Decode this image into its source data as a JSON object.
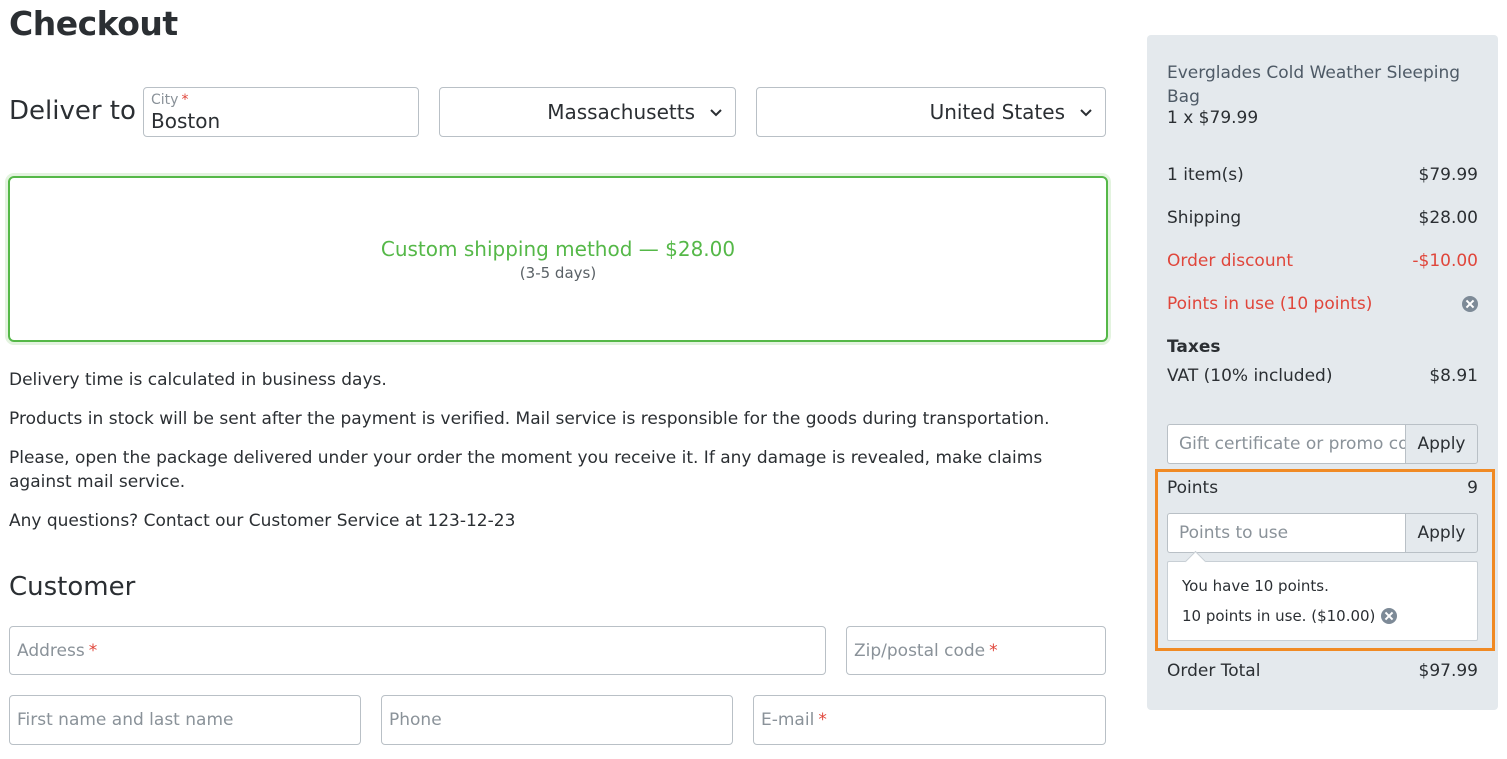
{
  "page": {
    "title": "Checkout"
  },
  "delivery": {
    "label": "Deliver to",
    "city_label": "City",
    "required_mark": "*",
    "city_value": "Boston",
    "state_value": "Massachusetts",
    "country_value": "United States"
  },
  "shipping": {
    "method": "Custom shipping method — $28.00",
    "days": "(3-5 days)"
  },
  "info": [
    "Delivery time is calculated in business days.",
    "Products in stock will be sent after the payment is verified. Mail service is responsible for the goods during transportation.",
    "Please, open the package delivered under your order the moment you receive it. If any damage is revealed, make claims against mail service.",
    "Any questions? Contact our Customer Service at 123-12-23"
  ],
  "customer": {
    "heading": "Customer",
    "address_placeholder": "Address",
    "zip_placeholder": "Zip/postal code",
    "name_placeholder": "First name and last name",
    "phone_placeholder": "Phone",
    "email_placeholder": "E-mail",
    "required_mark": "*"
  },
  "summary": {
    "product_name": "Everglades Cold Weather Sleeping Bag",
    "product_qty": "1 x $79.99",
    "items_label": "1 item(s)",
    "items_value": "$79.99",
    "shipping_label": "Shipping",
    "shipping_value": "$28.00",
    "discount_label": "Order discount",
    "discount_value": "-$10.00",
    "points_in_use_label": "Points in use (10 points)",
    "taxes_heading": "Taxes",
    "vat_label": "VAT (10% included)",
    "vat_value": "$8.91",
    "promo_placeholder": "Gift certificate or promo code",
    "promo_apply": "Apply",
    "points_label": "Points",
    "points_value": "9",
    "points_placeholder": "Points to use",
    "points_apply": "Apply",
    "popover_line1": "You have 10 points.",
    "popover_line2": "10 points in use. ($10.00)",
    "total_label": "Order Total",
    "total_value": "$97.99"
  },
  "colors": {
    "accent_green": "#55b848",
    "discount_red": "#e0463b",
    "highlight_orange": "#f08a24",
    "summary_bg": "#e4e9ed"
  }
}
